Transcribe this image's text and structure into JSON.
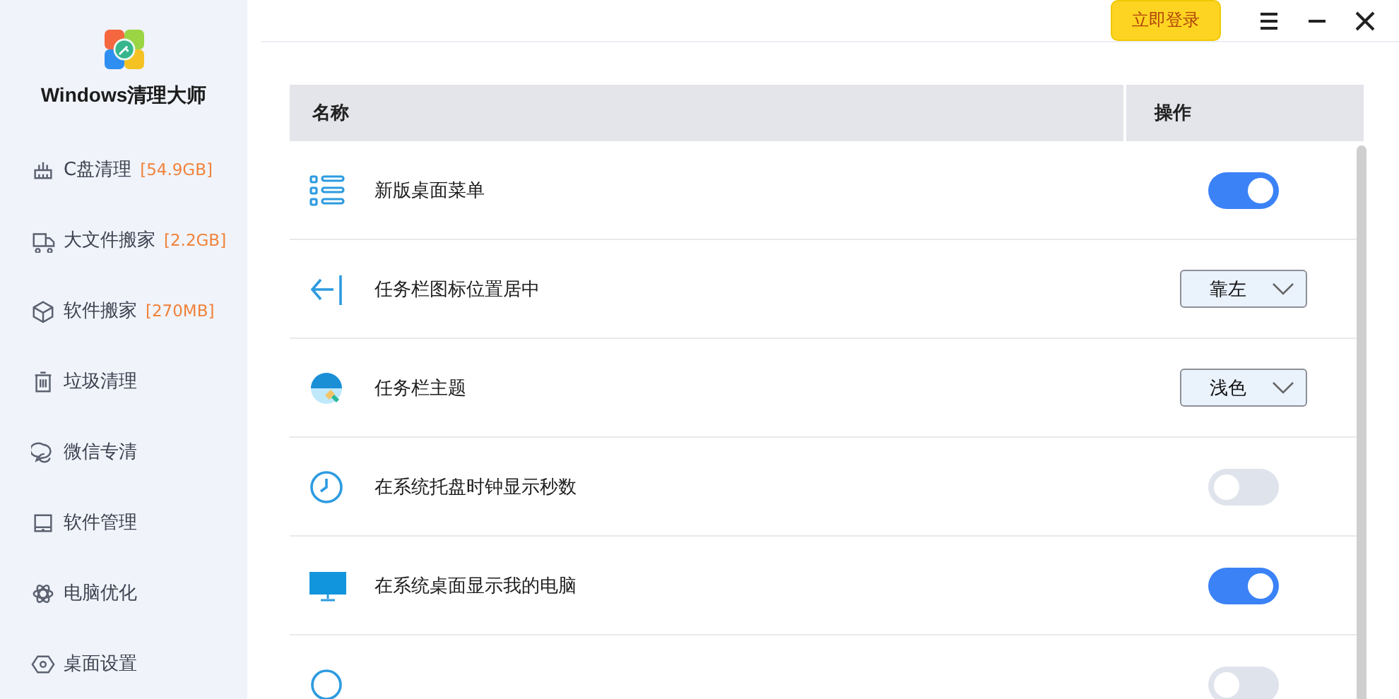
{
  "app": {
    "title": "Windows清理大师"
  },
  "sidebar": {
    "items": [
      {
        "label": "C盘清理",
        "badge": "[54.9GB]"
      },
      {
        "label": "大文件搬家",
        "badge": "[2.2GB]"
      },
      {
        "label": "软件搬家",
        "badge": "[270MB]"
      },
      {
        "label": "垃圾清理"
      },
      {
        "label": "微信专清"
      },
      {
        "label": "软件管理"
      },
      {
        "label": "电脑优化"
      },
      {
        "label": "桌面设置"
      }
    ]
  },
  "top_bar": {
    "login_button": "立即登录"
  },
  "table": {
    "columns": [
      "名称",
      "操作"
    ],
    "rows": [
      {
        "label": "新版桌面菜单",
        "kind": "toggle",
        "on": true
      },
      {
        "label": "任务栏图标位置居中",
        "kind": "select",
        "value": "靠左"
      },
      {
        "label": "任务栏主题",
        "kind": "select",
        "value": "浅色"
      },
      {
        "label": "在系统托盘时钟显示秒数",
        "kind": "toggle",
        "on": false
      },
      {
        "label": "在系统桌面显示我的电脑",
        "kind": "toggle",
        "on": true
      },
      {
        "kind": "toggle",
        "on": false
      }
    ]
  }
}
